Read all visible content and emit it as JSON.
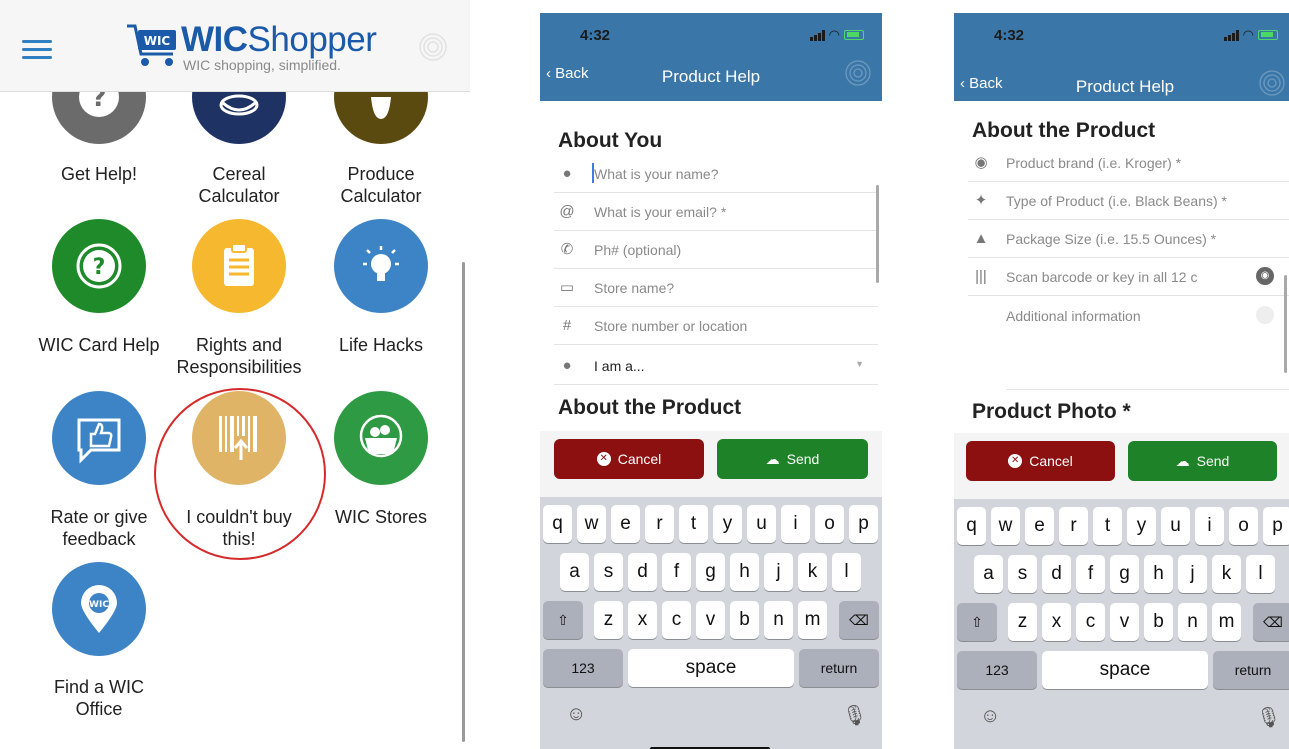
{
  "home": {
    "logo_badge": "WIC",
    "logo_bold": "WIC",
    "logo_light": "Shopper",
    "tagline": "WIC shopping, simplified.",
    "tiles": [
      {
        "label_lines": [
          "Get Help!"
        ],
        "icon": "question-icon",
        "color": "#6b6b6b"
      },
      {
        "label_lines": [
          "Cereal",
          "Calculator"
        ],
        "icon": "cereal-bowl-icon",
        "color": "#1f3264"
      },
      {
        "label_lines": [
          "Produce",
          "Calculator"
        ],
        "icon": "apple-icon",
        "color": "#5a4a10"
      },
      {
        "label_lines": [
          "WIC Card Help"
        ],
        "icon": "question-icon",
        "color": "#1e8a2a"
      },
      {
        "label_lines": [
          "Rights and",
          "Responsibilities"
        ],
        "icon": "clipboard-icon",
        "color": "#f5b82e"
      },
      {
        "label_lines": [
          "Life Hacks"
        ],
        "icon": "lightbulb-icon",
        "color": "#3d84c6"
      },
      {
        "label_lines": [
          "Rate or give",
          "feedback"
        ],
        "icon": "thumbs-up-icon",
        "color": "#3d84c6"
      },
      {
        "label_lines": [
          "I couldn't buy",
          "this!"
        ],
        "icon": "barcode-upload-icon",
        "color": "#e0b466"
      },
      {
        "label_lines": [
          "WIC Stores"
        ],
        "icon": "basket-icon",
        "color": "#2e9a44"
      },
      {
        "label_lines": [
          "Find a WIC",
          "Office"
        ],
        "icon": "map-pin-icon",
        "color": "#3d84c6"
      }
    ]
  },
  "screen_a": {
    "time": "4:32",
    "back_label": "Back",
    "title": "Product Help",
    "section_about_you": "About You",
    "fields": [
      {
        "icon": "user-icon",
        "placeholder": "What is your name?"
      },
      {
        "icon": "at-icon",
        "placeholder": "What is your email? *"
      },
      {
        "icon": "phone-icon",
        "placeholder": "Ph# (optional)"
      },
      {
        "icon": "store-icon",
        "placeholder": "Store name?"
      },
      {
        "icon": "hash-icon",
        "placeholder": "Store number or location"
      }
    ],
    "role_select": "I am a...",
    "section_about_product": "About the Product",
    "cancel_label": "Cancel",
    "send_label": "Send"
  },
  "screen_b": {
    "time": "4:32",
    "back_label": "Back",
    "title": "Product Help",
    "section_about_product": "About the Product",
    "fields": [
      {
        "icon": "brand-icon",
        "placeholder": "Product brand (i.e. Kroger) *"
      },
      {
        "icon": "product-type-icon",
        "placeholder": "Type of Product (i.e. Black Beans) *"
      },
      {
        "icon": "package-icon",
        "placeholder": "Package Size (i.e. 15.5 Ounces) *"
      },
      {
        "icon": "barcode-icon",
        "placeholder": "Scan barcode or key in all 12 c"
      }
    ],
    "additional_info": "Additional information",
    "section_photo": "Product Photo *",
    "cancel_label": "Cancel",
    "send_label": "Send"
  },
  "keyboard": {
    "row1": [
      "q",
      "w",
      "e",
      "r",
      "t",
      "y",
      "u",
      "i",
      "o",
      "p"
    ],
    "row2": [
      "a",
      "s",
      "d",
      "f",
      "g",
      "h",
      "j",
      "k",
      "l"
    ],
    "row3": [
      "z",
      "x",
      "c",
      "v",
      "b",
      "n",
      "m"
    ],
    "numbers_key": "123",
    "space_key": "space",
    "return_key": "return"
  }
}
